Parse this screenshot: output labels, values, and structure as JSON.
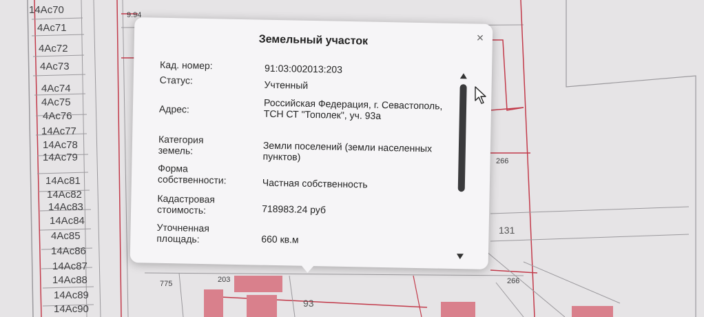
{
  "map": {
    "parcel_labels": [
      "14Ac70",
      "4Ac71",
      "4Ac72",
      "4Ac73",
      "4Ac74",
      "4Ac75",
      "4Ac76",
      "14Ac77",
      "14Ac78",
      "14Ac79",
      "14Ac81",
      "14Ac82",
      "14Ac83",
      "14Ac84",
      "4Ac85",
      "14Ac86",
      "14Ac87",
      "14Ac88",
      "14Ac89",
      "14Ac90"
    ],
    "numbers": {
      "n994": "9.94",
      "n266a": "266",
      "n131": "131",
      "n266b": "266",
      "n775": "775",
      "n203": "203",
      "n93": "93"
    },
    "colors": {
      "parcel_line": "#c23a4a",
      "parcel_fill": "#d9808c",
      "grid_line": "#9a989c"
    }
  },
  "popup": {
    "title": "Земельный участок",
    "close_glyph": "×",
    "fields": [
      {
        "label": "Кад. номер:",
        "value": "91:03:002013:203"
      },
      {
        "label": "Статус:",
        "value": "Учтенный"
      },
      {
        "label": "Адрес:",
        "value": "Российская Федерация, г. Севастополь, ТСН СТ \"Тополек\", уч. 93а"
      },
      {
        "label": "Категория земель:",
        "value": "Земли поселений (земли населенных пунктов)"
      },
      {
        "label": "Форма собственности:",
        "value": "Частная собственность"
      },
      {
        "label": "Кадастровая стоимость:",
        "value": "718983.24 руб"
      },
      {
        "label": "Уточненная площадь:",
        "value": "660 кв.м"
      }
    ],
    "icons": {
      "scroll_up": "triangle-up-icon",
      "scroll_down": "triangle-down-icon",
      "cursor": "mouse-pointer-icon"
    }
  }
}
